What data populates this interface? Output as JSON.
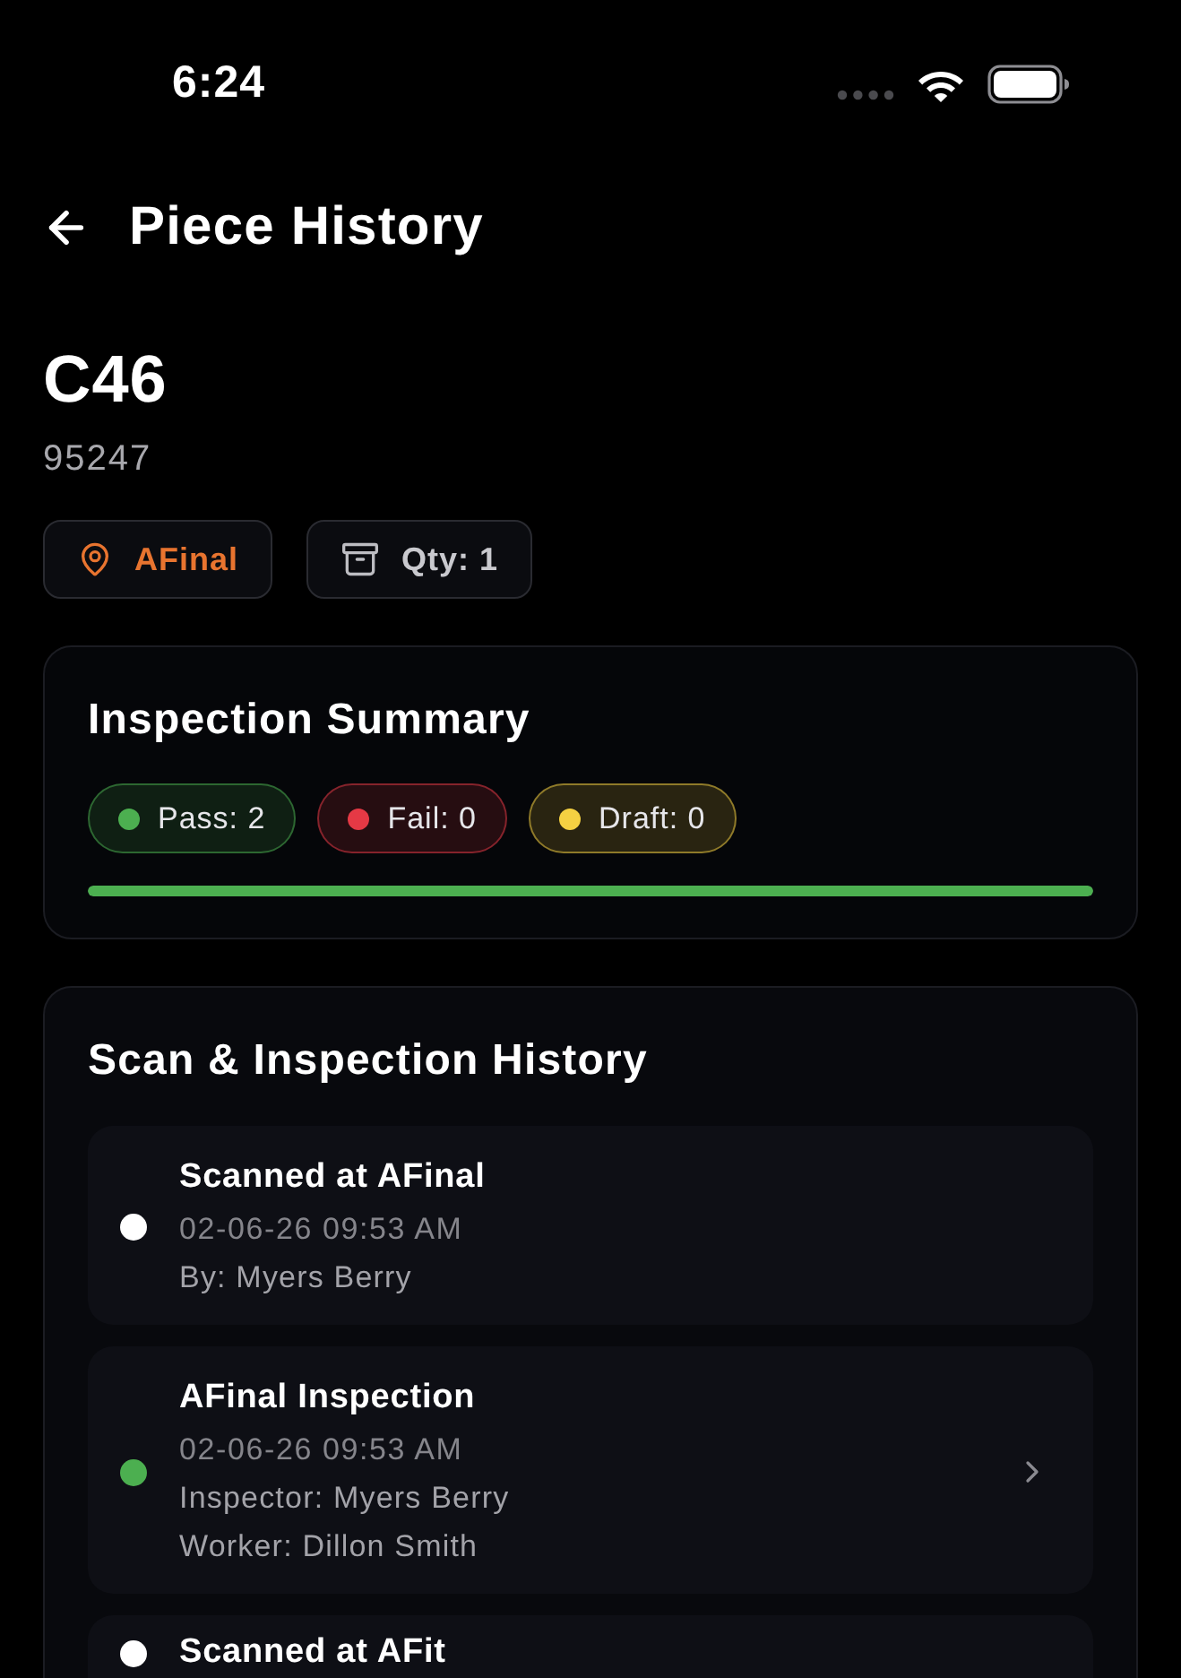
{
  "status_bar": {
    "time": "6:24"
  },
  "header": {
    "title": "Piece History"
  },
  "piece": {
    "code": "C46",
    "number": "95247",
    "chips": [
      {
        "kind": "location",
        "label": "AFinal"
      },
      {
        "kind": "quantity",
        "label": "Qty: 1"
      }
    ]
  },
  "inspection_summary": {
    "title": "Inspection Summary",
    "counts": [
      {
        "label": "Pass: 2",
        "color": "#4caf50"
      },
      {
        "label": "Fail: 0",
        "color": "#e53945"
      },
      {
        "label": "Draft: 0",
        "color": "#f5d142"
      }
    ],
    "progress": {
      "level": 1
    }
  },
  "history": {
    "title": "Scan & Inspection History",
    "entries": [
      {
        "color": "#ffffff",
        "title": "Scanned at AFinal",
        "date": "02-06-26 09:53 AM",
        "details": [
          "By: Myers Berry"
        ],
        "has_detail": false
      },
      {
        "color": "#4caf50",
        "title": "AFinal Inspection",
        "date": "02-06-26 09:53 AM",
        "details": [
          "Inspector: Myers Berry",
          "Worker: Dillon Smith"
        ],
        "has_detail": true
      },
      {
        "color": "#ffffff",
        "title": "Scanned at AFit",
        "has_detail": false
      }
    ]
  }
}
